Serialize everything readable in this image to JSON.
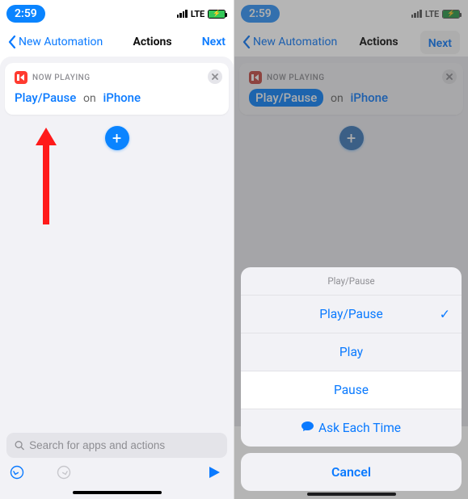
{
  "left": {
    "status": {
      "time": "2:59",
      "carrier": "LTE"
    },
    "nav": {
      "back": "New Automation",
      "title": "Actions",
      "next": "Next"
    },
    "card": {
      "nowPlaying": "NOW PLAYING",
      "action": "Play/Pause",
      "on": "on",
      "device": "iPhone"
    },
    "addLabel": "+",
    "search": {
      "placeholder": "Search for apps and actions"
    }
  },
  "right": {
    "status": {
      "time": "2:59",
      "carrier": "LTE"
    },
    "nav": {
      "back": "New Automation",
      "title": "Actions",
      "next": "Next"
    },
    "card": {
      "nowPlaying": "NOW PLAYING",
      "action": "Play/Pause",
      "on": "on",
      "device": "iPhone"
    },
    "sheet": {
      "title": "Play/Pause",
      "items": {
        "playpause": "Play/Pause",
        "play": "Play",
        "pause": "Pause",
        "ask": "Ask Each Time"
      },
      "cancel": "Cancel"
    }
  }
}
